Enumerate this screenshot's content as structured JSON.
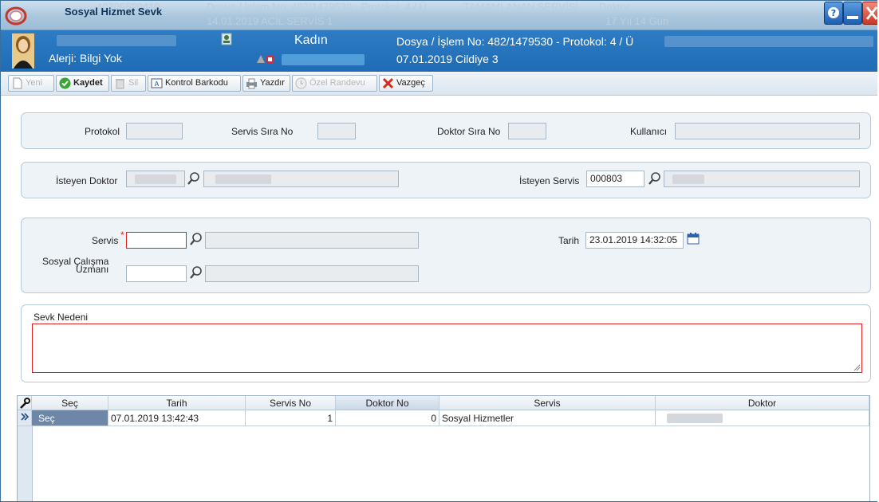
{
  "window": {
    "title": "Sosyal Hizmet Sevk"
  },
  "background_header": {
    "row1": [
      "40705529410",
      "Dosya / İşlem No: 482/1479530 - Protokol: 4 / Ü",
      "TAMAMLANAN  SERVİSİ",
      "Doktor"
    ],
    "row2": [
      "14.01.2019 ACİL SERVİS 1",
      "17 Yıl 14 Gün"
    ]
  },
  "patient": {
    "gender": "Kadın",
    "allergy": "Alerji: Bilgi Yok",
    "file_info": "Dosya / İşlem No: 482/1479530 - Protokol: 4 / Ü",
    "date_clinic": "07.01.2019 Cildiye 3"
  },
  "toolbar": {
    "new": "Yeni",
    "save": "Kaydet",
    "delete": "Sil",
    "barcode": "Kontrol Barkodu",
    "print": "Yazdır",
    "special": "Özel Randevu",
    "cancel": "Vazgeç"
  },
  "panel1": {
    "protokol_label": "Protokol",
    "protokol_value": "",
    "servis_sira_label": "Servis Sıra No",
    "servis_sira_value": "",
    "doktor_sira_label": "Doktor Sıra No",
    "doktor_sira_value": "",
    "kullanici_label": "Kullanıcı",
    "kullanici_value": ""
  },
  "panel2": {
    "isteyen_doktor_label": "İsteyen Doktor",
    "isteyen_servis_label": "İsteyen Servis",
    "isteyen_servis_code": "000803"
  },
  "panel3": {
    "servis_label": "Servis",
    "required_mark": "*",
    "servis_value": "",
    "tarih_label": "Tarih",
    "tarih_value": "23.01.2019 14:32:05",
    "uzman_label_1": "Sosyal Çalışma",
    "uzman_label_2": "Uzmanı",
    "uzman_value": ""
  },
  "sevk": {
    "label": "Sevk Nedeni",
    "value": ""
  },
  "grid": {
    "headers": [
      "Seç",
      "Tarih",
      "Servis No",
      "Doktor No",
      "Servis",
      "Doktor"
    ],
    "rows": [
      {
        "sec": "Seç",
        "tarih": "07.01.2019 13:42:43",
        "servis_no": "1",
        "doktor_no": "0",
        "servis": "Sosyal Hizmetler",
        "doktor": ""
      }
    ]
  },
  "colors": {
    "accent": "#1f6cb5",
    "required": "#e02020",
    "panel_bg": "#eef3f8"
  }
}
